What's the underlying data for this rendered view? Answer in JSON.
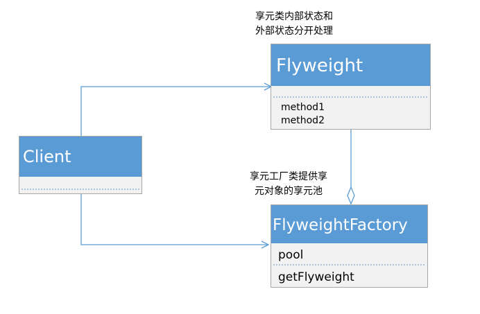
{
  "notes": {
    "flyweight_line1": "享元类内部状态和",
    "flyweight_line2": "外部状态分开处理",
    "factory_line1": "享元工厂类提供享",
    "factory_line2": "元对象的享元池"
  },
  "classes": {
    "flyweight": {
      "name": "Flyweight",
      "methods": [
        "method1",
        "method2"
      ]
    },
    "client": {
      "name": "Client"
    },
    "factory": {
      "name": "FlyweightFactory",
      "attributes": [
        "pool"
      ],
      "methods": [
        "getFlyweight"
      ]
    }
  },
  "colors": {
    "header": "#5b9bd5",
    "body": "#f2f2f2",
    "connector": "#5b9bd5"
  }
}
